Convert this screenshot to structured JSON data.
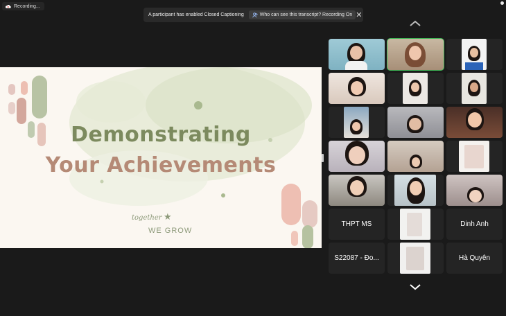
{
  "recording": {
    "label": "Recording..."
  },
  "banner": {
    "message": "A participant has enabled Closed Captioning",
    "button_label": "Who can see this transcript? Recording On",
    "close_glyph": "✕"
  },
  "slide": {
    "title_line1": "Demonstrating",
    "title_line2": "Your Achievements",
    "script_text": "together",
    "tagline": "WE GROW"
  },
  "participants": [
    {
      "id": "p1",
      "type": "video",
      "active": false
    },
    {
      "id": "p2",
      "type": "video",
      "active": true
    },
    {
      "id": "p3",
      "type": "video",
      "active": false
    },
    {
      "id": "p4",
      "type": "video",
      "active": false
    },
    {
      "id": "p5",
      "type": "video",
      "active": false
    },
    {
      "id": "p6",
      "type": "video",
      "active": false
    },
    {
      "id": "p7",
      "type": "video",
      "active": false
    },
    {
      "id": "p8",
      "type": "video",
      "active": false
    },
    {
      "id": "p9",
      "type": "video",
      "active": false
    },
    {
      "id": "p10",
      "type": "video",
      "active": false
    },
    {
      "id": "p11",
      "type": "video",
      "active": false
    },
    {
      "id": "p12",
      "type": "video",
      "active": false
    },
    {
      "id": "p13",
      "type": "video",
      "active": false
    },
    {
      "id": "p14",
      "type": "video",
      "active": false
    },
    {
      "id": "p15",
      "type": "video",
      "active": false
    },
    {
      "id": "p16",
      "type": "name",
      "name": "THPT MS"
    },
    {
      "id": "p17",
      "type": "video",
      "active": false
    },
    {
      "id": "p18",
      "type": "name",
      "name": "Dinh Anh"
    },
    {
      "id": "p19",
      "type": "name",
      "name": "S22087 - Đo..."
    },
    {
      "id": "p20",
      "type": "video",
      "active": false
    },
    {
      "id": "p21",
      "type": "name",
      "name": "Hà Quyên"
    }
  ],
  "colors": {
    "active_speaker_border": "#3fb856",
    "title_green": "#7c8a5e",
    "title_rose": "#b58a76",
    "background": "#1a1a1a"
  },
  "icons": {
    "recording": "cloud-recording-icon",
    "banner_button": "people-icon",
    "close": "close-icon",
    "page_up": "chevron-up-icon",
    "page_down": "chevron-down-icon"
  }
}
